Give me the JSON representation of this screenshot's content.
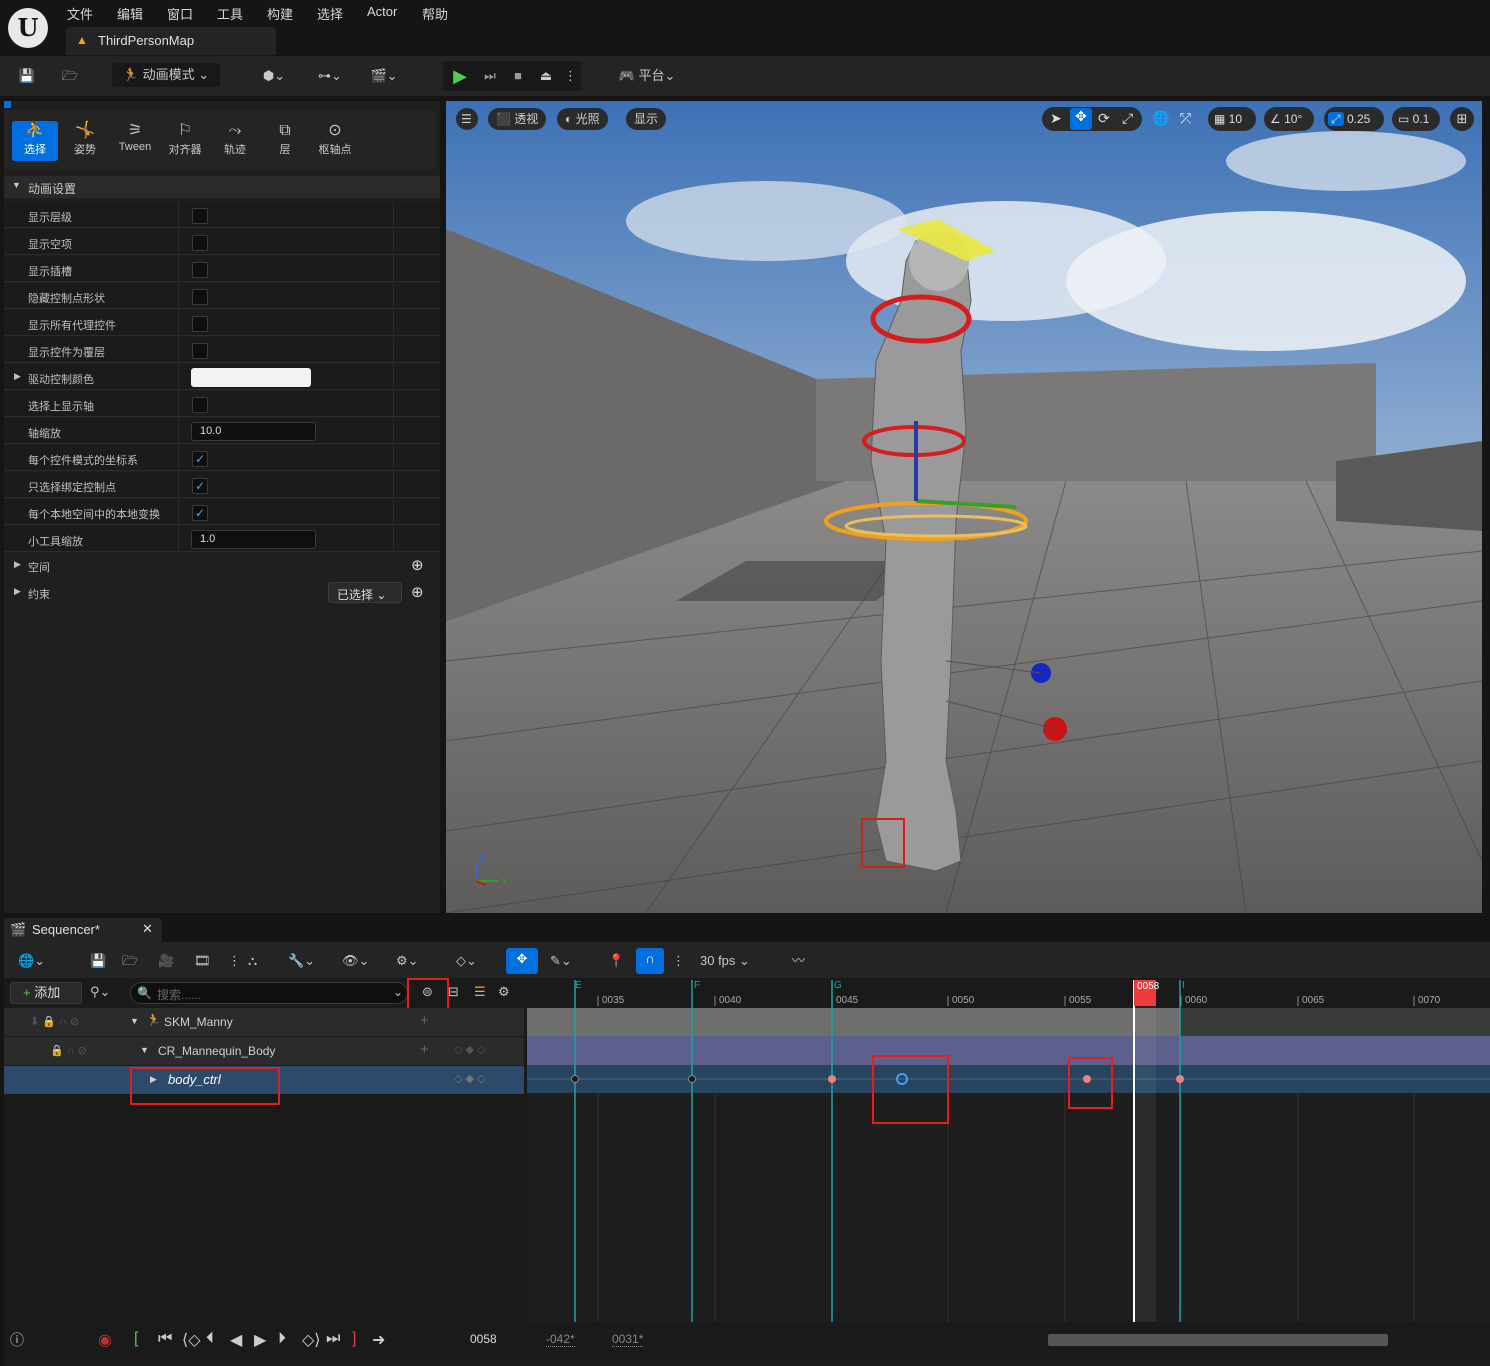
{
  "menu": [
    "文件",
    "编辑",
    "窗口",
    "工具",
    "构建",
    "选择",
    "Actor",
    "帮助"
  ],
  "level_tab": "ThirdPersonMap",
  "toolbar": {
    "mode": "动画模式",
    "platform": "平台"
  },
  "tools": [
    "选择",
    "姿势",
    "Tween",
    "对齐器",
    "轨迹",
    "层",
    "枢轴点"
  ],
  "section": "动画设置",
  "props": [
    {
      "label": "显示层级",
      "type": "cb",
      "checked": false
    },
    {
      "label": "显示空项",
      "type": "cb",
      "checked": false
    },
    {
      "label": "显示插槽",
      "type": "cb",
      "checked": false
    },
    {
      "label": "隐藏控制点形状",
      "type": "cb",
      "checked": false
    },
    {
      "label": "显示所有代理控件",
      "type": "cb",
      "checked": false
    },
    {
      "label": "显示控件为覆层",
      "type": "cb",
      "checked": false
    },
    {
      "label": "驱动控制颜色",
      "type": "color"
    },
    {
      "label": "选择上显示轴",
      "type": "cb",
      "checked": false
    },
    {
      "label": "轴缩放",
      "type": "num",
      "value": "10.0"
    },
    {
      "label": "每个控件模式的坐标系",
      "type": "cb",
      "checked": true
    },
    {
      "label": "只选择绑定控制点",
      "type": "cb",
      "checked": true
    },
    {
      "label": "每个本地空间中的本地变换",
      "type": "cb",
      "checked": true
    },
    {
      "label": "小工具缩放",
      "type": "num",
      "value": "1.0"
    }
  ],
  "space_label": "空间",
  "constraint_label": "约束",
  "constraint_dropdown": "已选择",
  "viewport": {
    "perspective": "透视",
    "lit": "光照",
    "show": "显示",
    "grid": "10",
    "angle": "10°",
    "scale": "0.25",
    "camera": "0.1"
  },
  "sequencer": {
    "tab": "Sequencer*",
    "fps": "30 fps",
    "add": "添加",
    "search_placeholder": "搜索......",
    "tracks": [
      "SKM_Manny",
      "CR_Mannequin_Body",
      "body_ctrl"
    ],
    "current_frame": "0058",
    "range_start": "-042*",
    "range_end": "0031*",
    "ticks": [
      "0035",
      "0040",
      "0045",
      "0050",
      "0055",
      "0060",
      "0065",
      "0070"
    ],
    "markers": [
      "E",
      "F",
      "G",
      "I"
    ]
  }
}
